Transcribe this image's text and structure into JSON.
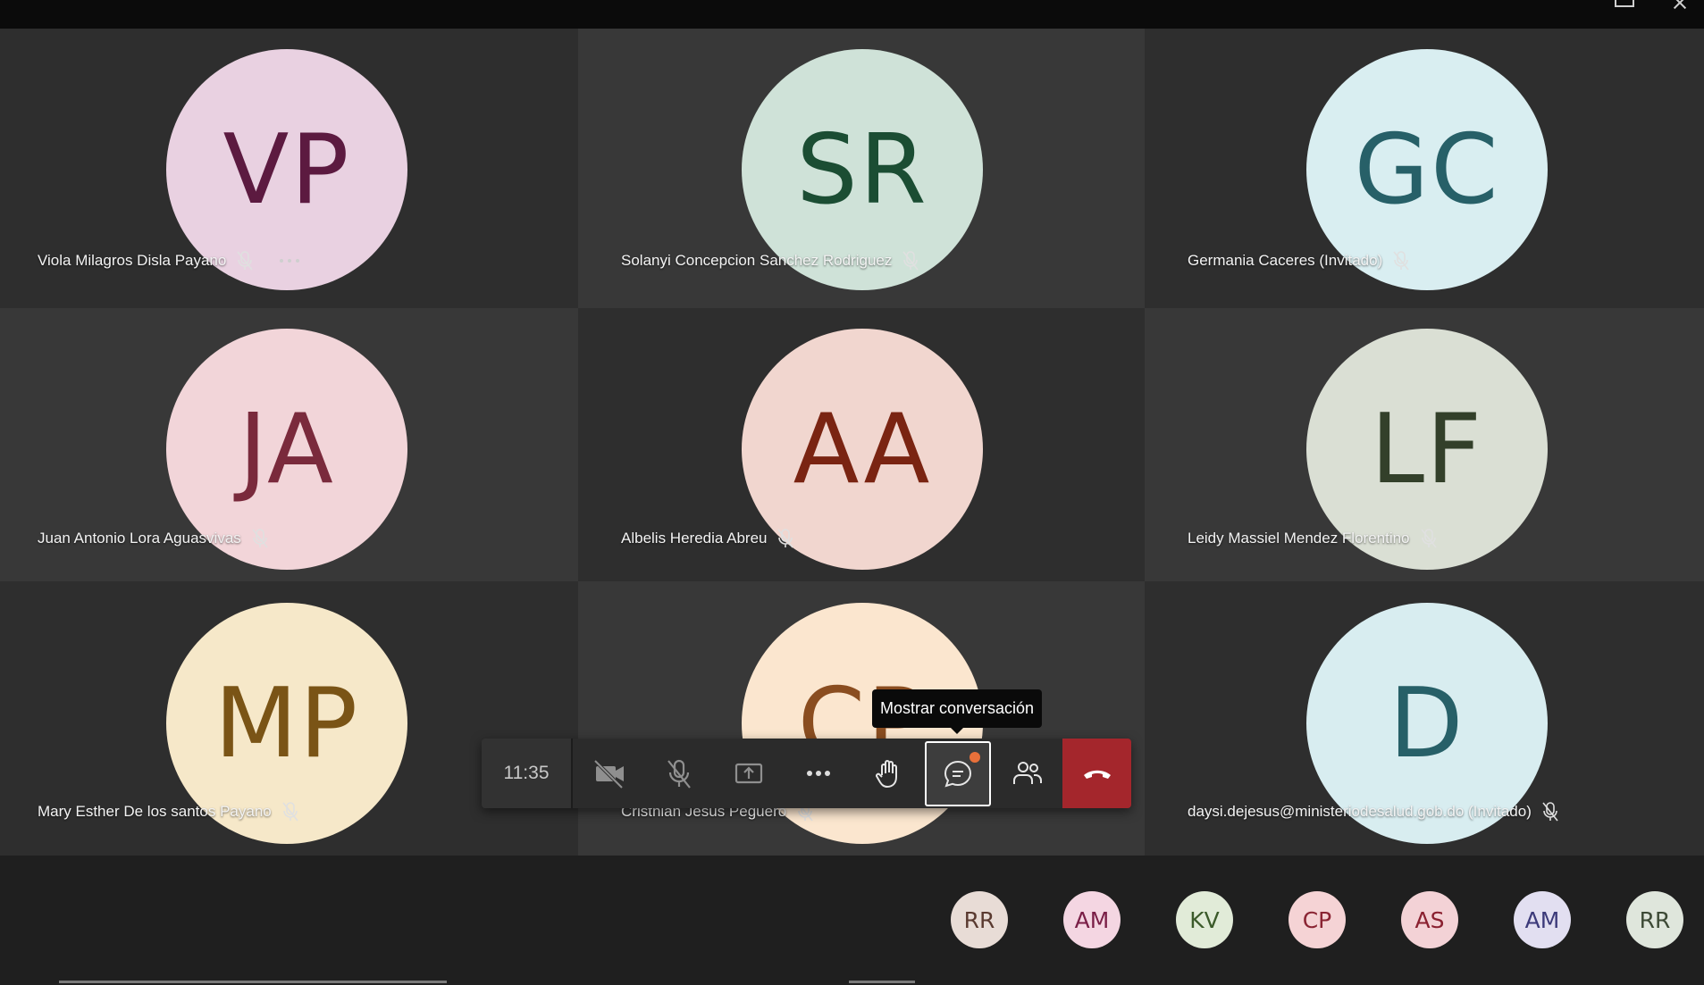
{
  "participants": [
    {
      "initials": "VP",
      "name": "Viola Milagros Disla Payano",
      "bg": "#e9d1e1",
      "fg": "#5c1a40",
      "muted": true
    },
    {
      "initials": "SR",
      "name": "Solanyi Concepcion Sanchez Rodriguez",
      "bg": "#cfe2d8",
      "fg": "#1b4d33",
      "muted": true
    },
    {
      "initials": "GC",
      "name": "Germania Caceres (Invitado)",
      "bg": "#d9eef1",
      "fg": "#276068",
      "muted": true
    },
    {
      "initials": "JA",
      "name": "Juan Antonio Lora Aguasvivas",
      "bg": "#f2d5d9",
      "fg": "#7a2a3c",
      "muted": true
    },
    {
      "initials": "AA",
      "name": "Albelis Heredia Abreu",
      "bg": "#f1d6cf",
      "fg": "#7a2412",
      "muted": true
    },
    {
      "initials": "LF",
      "name": "Leidy Massiel Mendez Florentino",
      "bg": "#dadfd4",
      "fg": "#33402a",
      "muted": true
    },
    {
      "initials": "MP",
      "name": "Mary Esther De los santos Payano",
      "bg": "#f6e8c9",
      "fg": "#7a5416",
      "muted": true
    },
    {
      "initials": "CP",
      "name": "Cristhian Jesus Peguero",
      "bg": "#fbe6cf",
      "fg": "#8a4d20",
      "muted": true
    },
    {
      "initials": "D",
      "name": "daysi.dejesus@ministeriodesalud.gob.do (Invitado)",
      "bg": "#d8edf0",
      "fg": "#276068",
      "muted": true
    }
  ],
  "overflow_participants": [
    {
      "initials": "RR",
      "bg": "#e8dcd6",
      "fg": "#5a3a30"
    },
    {
      "initials": "AM",
      "bg": "#f4d6e2",
      "fg": "#7a1f47"
    },
    {
      "initials": "KV",
      "bg": "#e1ebd8",
      "fg": "#3b5a2a"
    },
    {
      "initials": "CP",
      "bg": "#f5d3d5",
      "fg": "#8a2433"
    },
    {
      "initials": "AS",
      "bg": "#f3d2d6",
      "fg": "#8a2030"
    },
    {
      "initials": "AM",
      "bg": "#e2dff1",
      "fg": "#3c3a7a"
    },
    {
      "initials": "RR",
      "bg": "#dfe6dc",
      "fg": "#3d4a36"
    }
  ],
  "toolbar": {
    "time": "11:35",
    "camera": "camera-off-icon",
    "mic": "mic-off-icon",
    "share": "share-screen-icon",
    "more": "more-actions-icon",
    "raise_hand": "raise-hand-icon",
    "chat": "chat-icon",
    "people": "participants-icon",
    "hangup": "hang-up-icon",
    "accent": "#a4262c",
    "notification": "#e8703a"
  },
  "tooltip": {
    "text": "Mostrar conversación"
  }
}
